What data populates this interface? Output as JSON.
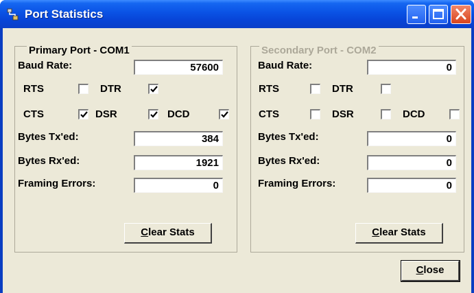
{
  "window": {
    "title": "Port Statistics"
  },
  "primary": {
    "legend": "Primary Port - COM1",
    "baud_label": "Baud Rate:",
    "baud_value": "57600",
    "rts_label": "RTS",
    "rts": false,
    "dtr_label": "DTR",
    "dtr": true,
    "cts_label": "CTS",
    "cts": true,
    "dsr_label": "DSR",
    "dsr": true,
    "dcd_label": "DCD",
    "dcd": true,
    "tx_label": "Bytes Tx'ed:",
    "tx_value": "384",
    "rx_label": "Bytes Rx'ed:",
    "rx_value": "1921",
    "fe_label": "Framing Errors:",
    "fe_value": "0",
    "clear_first": "C",
    "clear_rest": "lear Stats"
  },
  "secondary": {
    "legend": "Secondary Port - COM2",
    "baud_label": "Baud Rate:",
    "baud_value": "0",
    "rts_label": "RTS",
    "rts": false,
    "dtr_label": "DTR",
    "dtr": false,
    "cts_label": "CTS",
    "cts": false,
    "dsr_label": "DSR",
    "dsr": false,
    "dcd_label": "DCD",
    "dcd": false,
    "tx_label": "Bytes Tx'ed:",
    "tx_value": "0",
    "rx_label": "Bytes Rx'ed:",
    "rx_value": "0",
    "fe_label": "Framing Errors:",
    "fe_value": "0",
    "clear_first": "C",
    "clear_rest": "lear Stats"
  },
  "close_button": {
    "first": "C",
    "rest": "lose"
  },
  "icons": {
    "app": "network-ports-icon",
    "minimize": "minimize-icon",
    "maximize": "maximize-icon",
    "close": "close-icon"
  }
}
